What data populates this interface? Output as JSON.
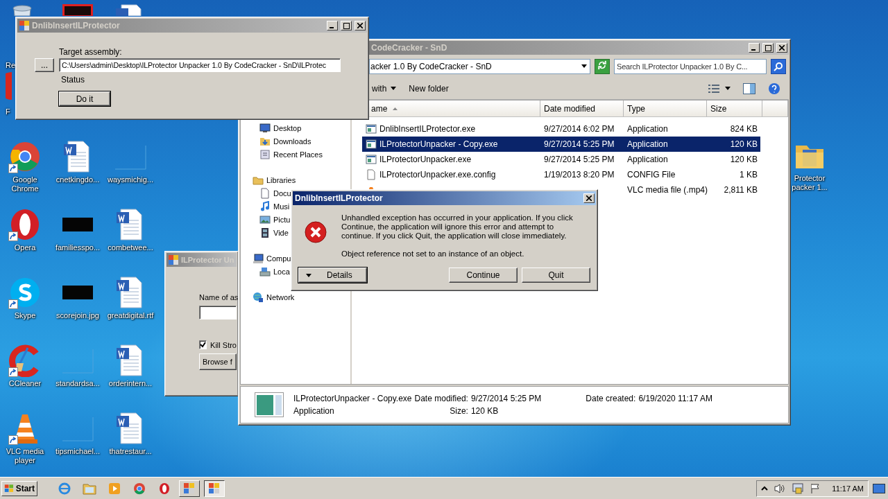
{
  "desktop": {
    "icons": [
      {
        "kind": "recycle",
        "label": "Re"
      },
      {
        "kind": "firefox",
        "label": "F"
      },
      {
        "kind": "chrome",
        "label": "Google Chrome"
      },
      {
        "kind": "opera",
        "label": "Opera"
      },
      {
        "kind": "skype",
        "label": "Skype"
      },
      {
        "kind": "ccleaner",
        "label": "CCleaner"
      },
      {
        "kind": "vlc",
        "label": "VLC media player"
      },
      {
        "kind": "thumb_top"
      },
      {
        "kind": "empty"
      },
      {
        "kind": "word",
        "label": "cnetkingdo..."
      },
      {
        "kind": "black",
        "label": "familiesspo..."
      },
      {
        "kind": "black",
        "label": "scorejoin.jpg"
      },
      {
        "kind": "blank",
        "label": "standardsa..."
      },
      {
        "kind": "blank",
        "label": "tipsmichael..."
      },
      {
        "kind": "word_top"
      },
      {
        "kind": "empty"
      },
      {
        "kind": "blank",
        "label": "waysmichig..."
      },
      {
        "kind": "word",
        "label": "combetwee..."
      },
      {
        "kind": "word",
        "label": "greatdigital.rtf"
      },
      {
        "kind": "word",
        "label": "orderintern..."
      },
      {
        "kind": "word",
        "label": "thatrestaur..."
      }
    ],
    "right_icon": {
      "kind": "folder",
      "label": "Protector packer 1..."
    }
  },
  "unpacker_window": {
    "title": "ILProtector Un",
    "active": false,
    "name_label": "Name of as",
    "kill_checkbox": {
      "label": "Kill Stro",
      "checked": true
    },
    "browse_button": "Browse f"
  },
  "explorer": {
    "title": "CodeCracker - SnD",
    "active": false,
    "address": "acker 1.0 By CodeCracker - SnD",
    "search": {
      "placeholder": "Search ILProtector Unpacker 1.0 By C..."
    },
    "toolbar": [
      {
        "label": "with",
        "dropdown": true
      },
      {
        "label": "New folder",
        "dropdown": false
      }
    ],
    "nav": [
      {
        "children": [
          {
            "label": "Desktop",
            "kind": "desktop"
          },
          {
            "label": "Downloads",
            "kind": "downloads"
          },
          {
            "label": "Recent Places",
            "kind": "recent"
          }
        ]
      },
      {
        "label": "Libraries",
        "kind": "libraries",
        "children": [
          {
            "label": "Docu",
            "kind": "documents"
          },
          {
            "label": "Musi",
            "kind": "music"
          },
          {
            "label": "Pictu",
            "kind": "pictures"
          },
          {
            "label": "Vide",
            "kind": "videos"
          }
        ]
      },
      {
        "label": "Compu",
        "kind": "computer",
        "children": [
          {
            "label": "Loca",
            "kind": "disk"
          }
        ]
      },
      {
        "label": "Network",
        "kind": "network"
      }
    ],
    "columns": [
      "ame",
      "Date modified",
      "Type",
      "Size"
    ],
    "files": [
      {
        "kind": "exe",
        "name": "DnlibInsertILProtector.exe",
        "date": "9/27/2014 6:02 PM",
        "type": "Application",
        "size": "824 KB",
        "selected": false
      },
      {
        "kind": "exe",
        "name": "ILProtectorUnpacker - Copy.exe",
        "date": "9/27/2014 5:25 PM",
        "type": "Application",
        "size": "120 KB",
        "selected": true
      },
      {
        "kind": "exe",
        "name": "ILProtectorUnpacker.exe",
        "date": "9/27/2014 5:25 PM",
        "type": "Application",
        "size": "120 KB",
        "selected": false
      },
      {
        "kind": "config",
        "name": "ILProtectorUnpacker.exe.config",
        "date": "1/19/2013 8:20 PM",
        "type": "CONFIG File",
        "size": "1 KB",
        "selected": false
      },
      {
        "kind": "vlc",
        "type": "VLC media file (.mp4)",
        "size": "2,811 KB",
        "selected": false
      }
    ],
    "details": {
      "name": "ILProtectorUnpacker - Copy.exe",
      "type": "Application",
      "date_modified_label": "Date modified:",
      "date_modified": "9/27/2014 5:25 PM",
      "size_label": "Size:",
      "size": "120 KB",
      "date_created_label": "Date created:",
      "date_created": "6/19/2020 11:17 AM"
    }
  },
  "main_window": {
    "title": "DnlibInsertILProtector",
    "active": false,
    "browse_button": "...",
    "target_label": "Target assembly:",
    "target_value": "C:\\Users\\admin\\Desktop\\ILProtector Unpacker 1.0 By CodeCracker - SnD\\ILProtec",
    "status": "Status",
    "run_button": "Do it"
  },
  "error_dialog": {
    "title": "DnlibInsertILProtector",
    "active": true,
    "message": "Unhandled exception has occurred in your application. If you click Continue, the application will ignore this error and attempt to continue. If you click Quit, the application will close immediately.",
    "detail": "Object reference not set to an instance of an object.",
    "buttons": [
      {
        "label": "Details",
        "kind": "expander",
        "default": true
      },
      {
        "label": "Continue",
        "kind": "plain",
        "default": false
      },
      {
        "label": "Quit",
        "kind": "plain",
        "default": false
      }
    ]
  },
  "taskbar": {
    "start": "Start",
    "quick_launch": [
      {
        "kind": "ie"
      },
      {
        "kind": "explorer"
      },
      {
        "kind": "media"
      },
      {
        "kind": "chrome"
      },
      {
        "kind": "opera"
      }
    ],
    "tasks": [
      {
        "kind": "app",
        "selected": false
      },
      {
        "kind": "app",
        "selected": true
      }
    ],
    "tray": [
      {
        "kind": "up"
      },
      {
        "kind": "speaker"
      },
      {
        "kind": "network"
      },
      {
        "kind": "flag"
      }
    ],
    "clock": "11:17 AM"
  }
}
